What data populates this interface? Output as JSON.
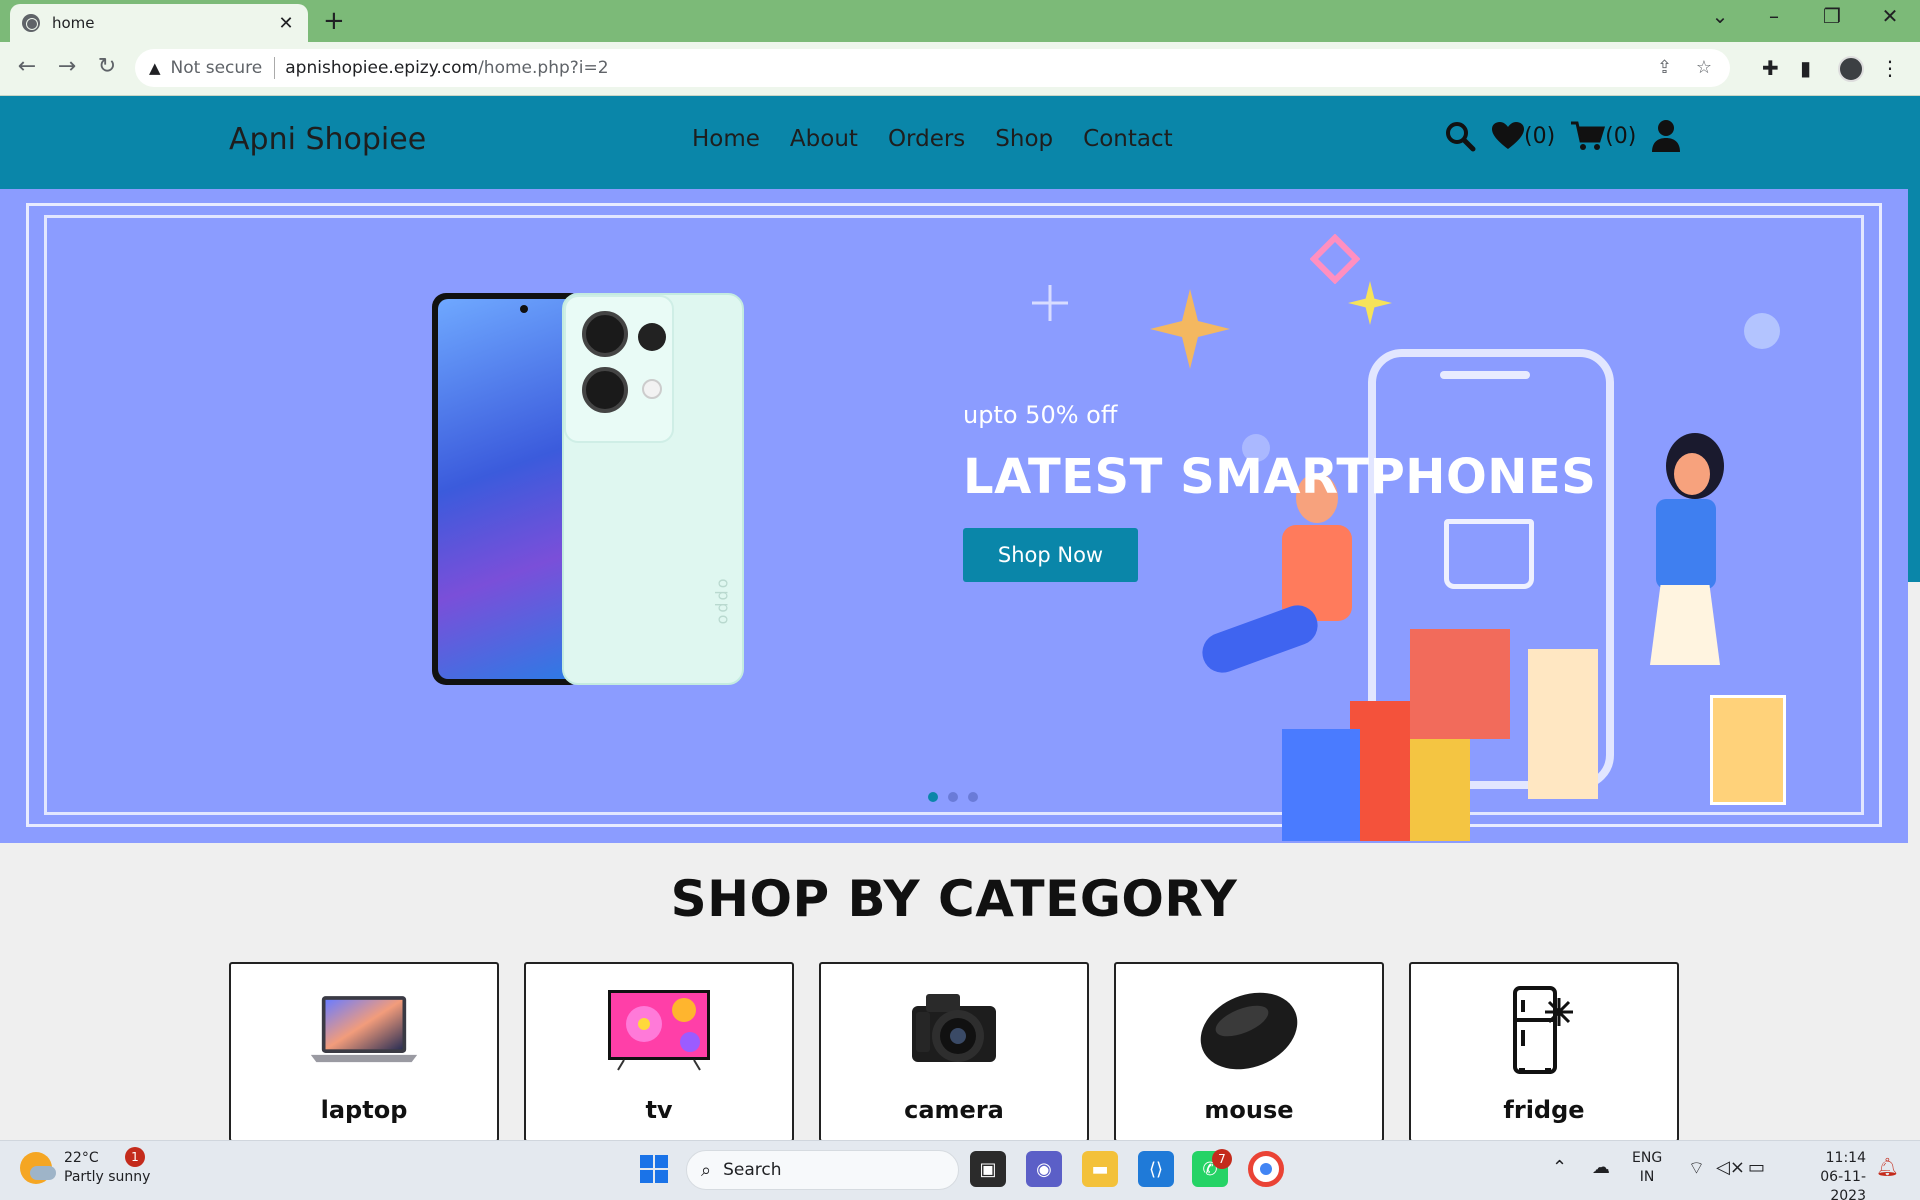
{
  "browser": {
    "tab_title": "home",
    "tab_close": "✕",
    "new_tab": "+",
    "security_label": "Not secure",
    "url_host": "apnishopiee.epizy.com",
    "url_path": "/home.php?i=2"
  },
  "site": {
    "logo": "Apni Shopiee",
    "nav": [
      "Home",
      "About",
      "Orders",
      "Shop",
      "Contact"
    ],
    "wishlist_count": "(0)",
    "cart_count": "(0)",
    "accent_color": "#0a86a9"
  },
  "hero": {
    "subtitle": "upto 50% off",
    "title": "LATEST SMARTPHONES",
    "button": "Shop Now",
    "phone_brand": "oppo",
    "slide_count": 3,
    "active_slide": 1,
    "background": "#8b9cff"
  },
  "categories": {
    "title": "SHOP BY CATEGORY",
    "items": [
      {
        "label": "laptop",
        "icon": "laptop-icon"
      },
      {
        "label": "tv",
        "icon": "tv-icon"
      },
      {
        "label": "camera",
        "icon": "camera-icon"
      },
      {
        "label": "mouse",
        "icon": "mouse-icon"
      },
      {
        "label": "fridge",
        "icon": "fridge-icon"
      }
    ]
  },
  "taskbar": {
    "temperature": "22°C",
    "weather": "Partly sunny",
    "weather_badge": "1",
    "search_placeholder": "Search",
    "whatsapp_badge": "7",
    "lang_top": "ENG",
    "lang_bottom": "IN",
    "time": "11:14",
    "date": "06-11-2023"
  }
}
